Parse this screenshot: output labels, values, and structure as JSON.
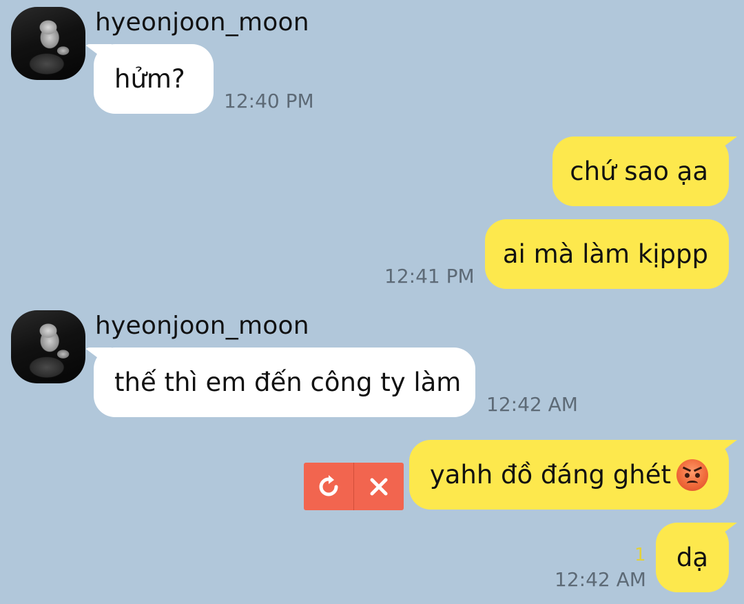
{
  "chat": {
    "groups": [
      {
        "sender": "hyeonjoon_moon",
        "message": "hửm?",
        "time": "12:40 PM"
      },
      {
        "messages": [
          "chứ sao ạa",
          "ai mà làm kịppp"
        ],
        "time": "12:41 PM"
      },
      {
        "sender": "hyeonjoon_moon",
        "message": "thế thì em đến công ty làm",
        "time": "12:42 AM"
      },
      {
        "message": "yahh đồ đáng ghét",
        "emoji": "angry-face-emoji",
        "status": "failed"
      },
      {
        "message": "dạ",
        "time": "12:42 AM",
        "unread_count": "1"
      }
    ]
  },
  "colors": {
    "background": "#b1c7da",
    "incoming_bubble": "#ffffff",
    "outgoing_bubble": "#fde84d",
    "timestamp": "#5d6a76",
    "unread": "#e3d13b",
    "failed_action": "#f2654f"
  },
  "icons": {
    "retry": "retry-icon",
    "delete": "close-icon"
  }
}
